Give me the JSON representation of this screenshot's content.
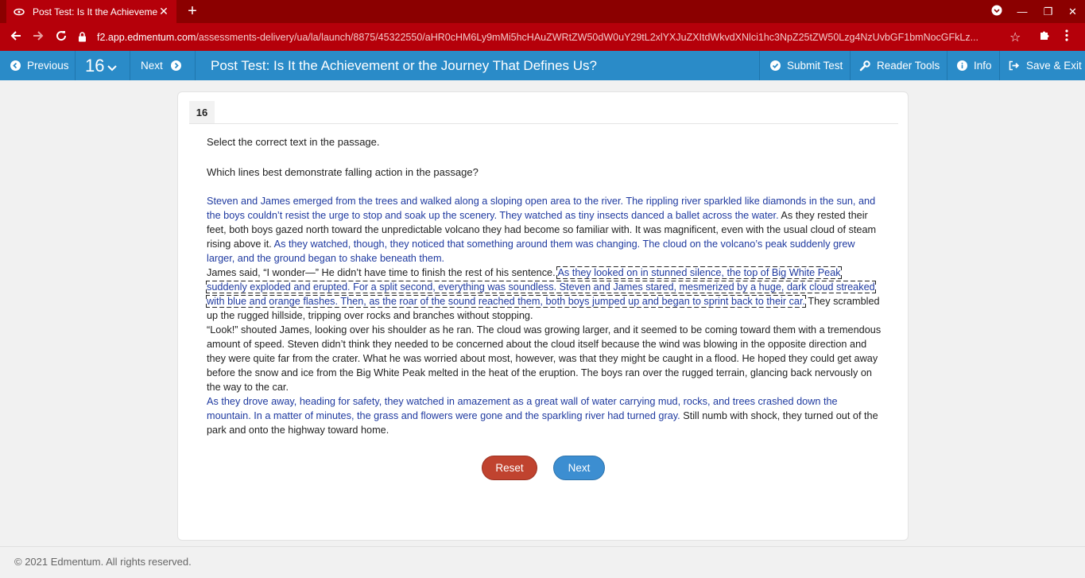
{
  "browser": {
    "tab_title": "Post Test: Is It the Achievement",
    "tab_close": "✕",
    "new_tab": "+",
    "url_host": "f2.app.edmentum.com",
    "url_path": "/assessments-delivery/ua/la/launch/8875/45322550/aHR0cHM6Ly9mMi5hcHAuZWRtZW50dW0uY29tL2xlYXJuZXItdWkvdXNlci1hc3NpZ25tZW50Lzg4NzUvbGF1bmNocGFkLz...",
    "window": {
      "minimize": "—",
      "maximize": "❐",
      "close": "✕"
    }
  },
  "toolbar": {
    "previous": "Previous",
    "question_number": "16",
    "next": "Next",
    "title": "Post Test: Is It the Achievement or the Journey That Defines Us?",
    "submit": "Submit Test",
    "reader_tools": "Reader Tools",
    "info": "Info",
    "save_exit": "Save & Exit"
  },
  "question": {
    "number": "16",
    "instruction": "Select the correct text in the passage.",
    "prompt": "Which lines best demonstrate falling action in the passage?",
    "passage": {
      "p1_hot1": "Steven and James emerged from the trees and walked along a sloping open area to the river. The rippling river sparkled like diamonds in the sun, and the boys couldn’t resist the urge to stop and soak up the scenery. They watched as tiny insects danced a ballet across the water.",
      "p1_plain1": " As they rested their feet, both boys gazed north toward the unpredictable volcano they had become so familiar with. It was magnificent, even with the usual cloud of steam rising above it. ",
      "p1_hot2": "As they watched, though, they noticed that something around them was changing. The cloud on the volcano’s peak suddenly grew larger, and the ground began to shake beneath them.",
      "p2_plain1": "James said, “I wonder—” He didn’t have time to finish the rest of his sentence. ",
      "p2_sel": "As they looked on in stunned silence, the top of Big White Peak suddenly exploded and erupted. For a split second, everything was soundless. Steven and James stared, mesmerized by a huge, dark cloud streaked with blue and orange flashes. Then, as the roar of the sound reached them, both boys jumped up and began to sprint back to their car.",
      "p2_plain2": " They scrambled up the rugged hillside, tripping over rocks and branches without stopping.",
      "p3_plain": "“Look!” shouted James, looking over his shoulder as he ran. The cloud was growing larger, and it seemed to be coming toward them with a tremendous amount of speed. Steven didn’t think they needed to be concerned about the cloud itself because the wind was blowing in the opposite direction and they were quite far from the crater. What he was worried about most, however, was that they might be caught in a flood. He hoped they could get away before the snow and ice from the Big White Peak melted in the heat of the eruption. The boys ran over the rugged terrain, glancing back nervously on the way to the car.",
      "p4_hot": "As they drove away, heading for safety, they watched in amazement as a great wall of water carrying mud, rocks, and trees crashed down the mountain. In a matter of minutes, the grass and flowers were gone and the sparkling river had turned gray.",
      "p4_plain": " Still numb with shock, they turned out of the park and onto the highway toward home."
    },
    "reset": "Reset",
    "next": "Next"
  },
  "footer": "© 2021 Edmentum. All rights reserved.",
  "colors": {
    "tab_strip": "#8b0000",
    "chrome": "#b5000a",
    "toolbar": "#2a8bc8",
    "hot_text": "#1f3aa0",
    "reset": "#c0432f",
    "next": "#3c8ed1"
  }
}
